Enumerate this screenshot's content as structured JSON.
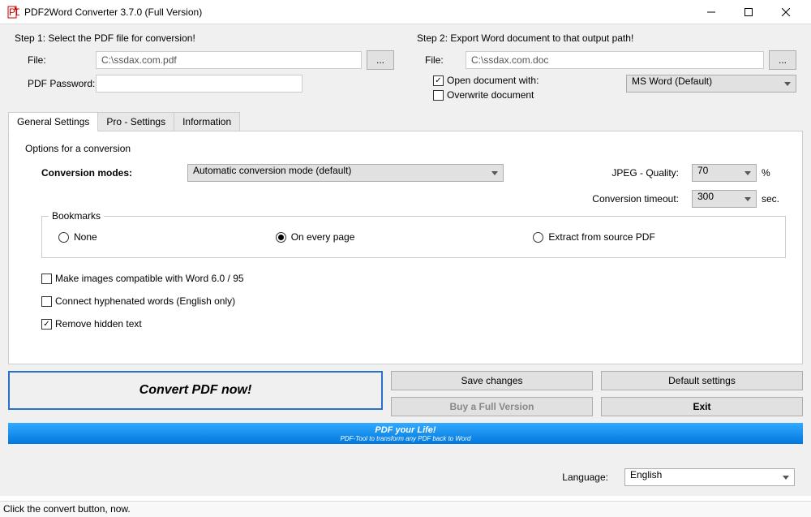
{
  "window": {
    "title": "PDF2Word Converter 3.7.0 (Full Version)"
  },
  "step1": {
    "title": "Step 1: Select the PDF file for conversion!",
    "file_label": "File:",
    "file_value": "C:\\ssdax.com.pdf",
    "browse": "...",
    "pwd_label": "PDF Password:"
  },
  "step2": {
    "title": "Step 2: Export Word document to that output path!",
    "file_label": "File:",
    "file_value": "C:\\ssdax.com.doc",
    "browse": "...",
    "open_label": "Open document with:",
    "open_value": "MS Word (Default)",
    "overwrite_label": "Overwrite document"
  },
  "tabs": {
    "general": "General Settings",
    "pro": "Pro - Settings",
    "info": "Information"
  },
  "options": {
    "title": "Options for a conversion",
    "mode_label": "Conversion modes:",
    "mode_value": "Automatic conversion mode (default)",
    "jpeg_label": "JPEG - Quality:",
    "jpeg_value": "70",
    "jpeg_unit": "%",
    "timeout_label": "Conversion timeout:",
    "timeout_value": "300",
    "timeout_unit": "sec.",
    "bookmarks_label": "Bookmarks",
    "bm_none": "None",
    "bm_every": "On every page",
    "bm_extract": "Extract from source PDF",
    "chk_compat": "Make images compatible with Word 6.0 / 95",
    "chk_hyphen": "Connect hyphenated words (English only)",
    "chk_hidden": "Remove hidden text"
  },
  "buttons": {
    "convert": "Convert PDF now!",
    "save": "Save changes",
    "defaults": "Default settings",
    "buy": "Buy a Full Version",
    "exit": "Exit"
  },
  "banner": {
    "line1": "PDF your Life!",
    "line2": "PDF-Tool to transform any PDF back to Word"
  },
  "lang": {
    "label": "Language:",
    "value": "English"
  },
  "status": "Click the convert button, now."
}
